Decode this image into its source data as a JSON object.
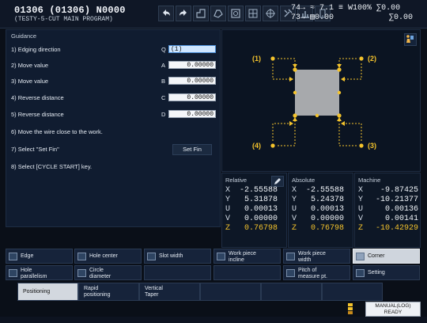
{
  "header": {
    "program_title": "01306 (01306) N0000",
    "program_subtitle": "(TESTY-5-CUT MAIN PROGRAM)",
    "stats_row1": [
      "74→",
      "≈ 7.1",
      "≡",
      "W100%",
      "∑0.00"
    ],
    "stats_row2": [
      "73→",
      "▤0.00",
      "",
      "",
      "∑0.00"
    ]
  },
  "guidance": {
    "title": "Guidance",
    "steps": [
      "1) Edging direction",
      "2) Move value",
      "3) Move value",
      "4) Reverse distance",
      "5) Reverse distance",
      "6) Move the wire close to the work.",
      "7) Select \"Set Fin\"",
      "8) Select [CYCLE START] key."
    ],
    "fields": [
      {
        "letter": "Q",
        "value": "(1)"
      },
      {
        "letter": "A",
        "value": "0.00000"
      },
      {
        "letter": "B",
        "value": "0.00000"
      },
      {
        "letter": "C",
        "value": "0.00000"
      },
      {
        "letter": "D",
        "value": "0.00000"
      }
    ],
    "set_fin_label": "Set Fin"
  },
  "diagram": {
    "labels": [
      "(1)",
      "(2)",
      "(3)",
      "(4)"
    ],
    "colors": {
      "accent": "#f4c32c",
      "block": "#a7a9ac"
    }
  },
  "coords": {
    "relative": {
      "title": "Relative",
      "axes": [
        "X",
        "Y",
        "U",
        "V",
        "Z"
      ],
      "values": [
        "-2.55588",
        "5.31878",
        "0.00013",
        "0.00000",
        "0.76798"
      ]
    },
    "absolute": {
      "title": "Absolute",
      "axes": [
        "X",
        "Y",
        "U",
        "V",
        "Z"
      ],
      "values": [
        "-2.55588",
        "5.24378",
        "0.00013",
        "0.00000",
        "0.76798"
      ]
    },
    "machine": {
      "title": "Machine",
      "axes": [
        "X",
        "Y",
        "U",
        "V",
        "Z"
      ],
      "values": [
        "-9.87425",
        "-10.21377",
        "0.00136",
        "0.00141",
        "-10.42929"
      ]
    }
  },
  "function_buttons": {
    "row1": [
      "Edge",
      "Hole center",
      "Slot width",
      "Work piece\nincline",
      "Work piece\nwidth",
      "Corner"
    ],
    "row2": [
      "Hole\nparallelism",
      "Circle\ndiameter",
      "",
      "",
      "Pitch of\nmeasure pt.",
      "Setting"
    ]
  },
  "tabs": [
    "Positioning",
    "Rapid\npositioning",
    "Vertical\nTaper",
    "",
    "",
    ""
  ],
  "status": {
    "line1": "MANUAL(LOG)",
    "line2": "READY"
  }
}
